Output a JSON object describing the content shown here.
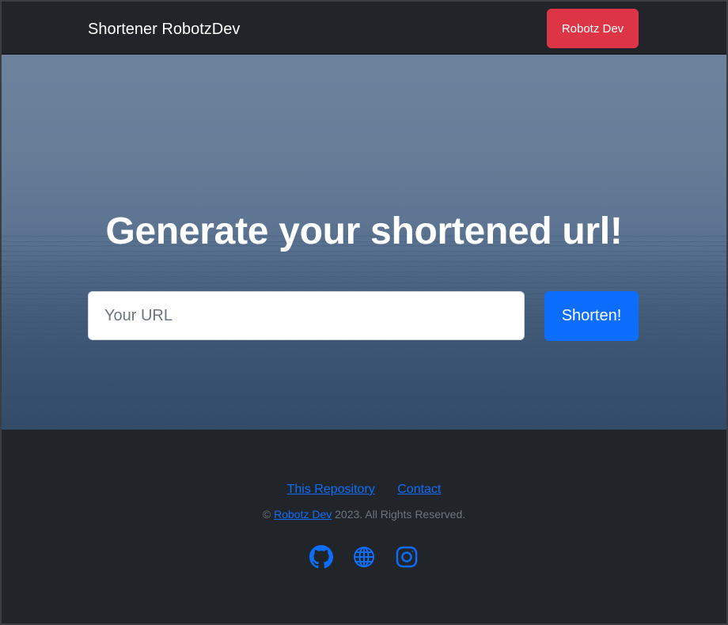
{
  "navbar": {
    "brand": "Shortener RobotzDev",
    "button_label": "Robotz Dev"
  },
  "hero": {
    "title": "Generate your shortened url!",
    "input_placeholder": "Your URL",
    "input_value": "",
    "shorten_label": "Shorten!"
  },
  "footer": {
    "links": [
      {
        "label": "This Repository"
      },
      {
        "label": "Contact"
      }
    ],
    "copyright_prefix": "©",
    "copyright_link": "Robotz Dev",
    "copyright_suffix": "2023. All Rights Reserved.",
    "social_icons": [
      "github-icon",
      "globe-icon",
      "instagram-icon"
    ]
  },
  "colors": {
    "navbar_bg": "#212529",
    "danger": "#dc3545",
    "primary": "#0d6efd",
    "muted": "#6c757d"
  }
}
